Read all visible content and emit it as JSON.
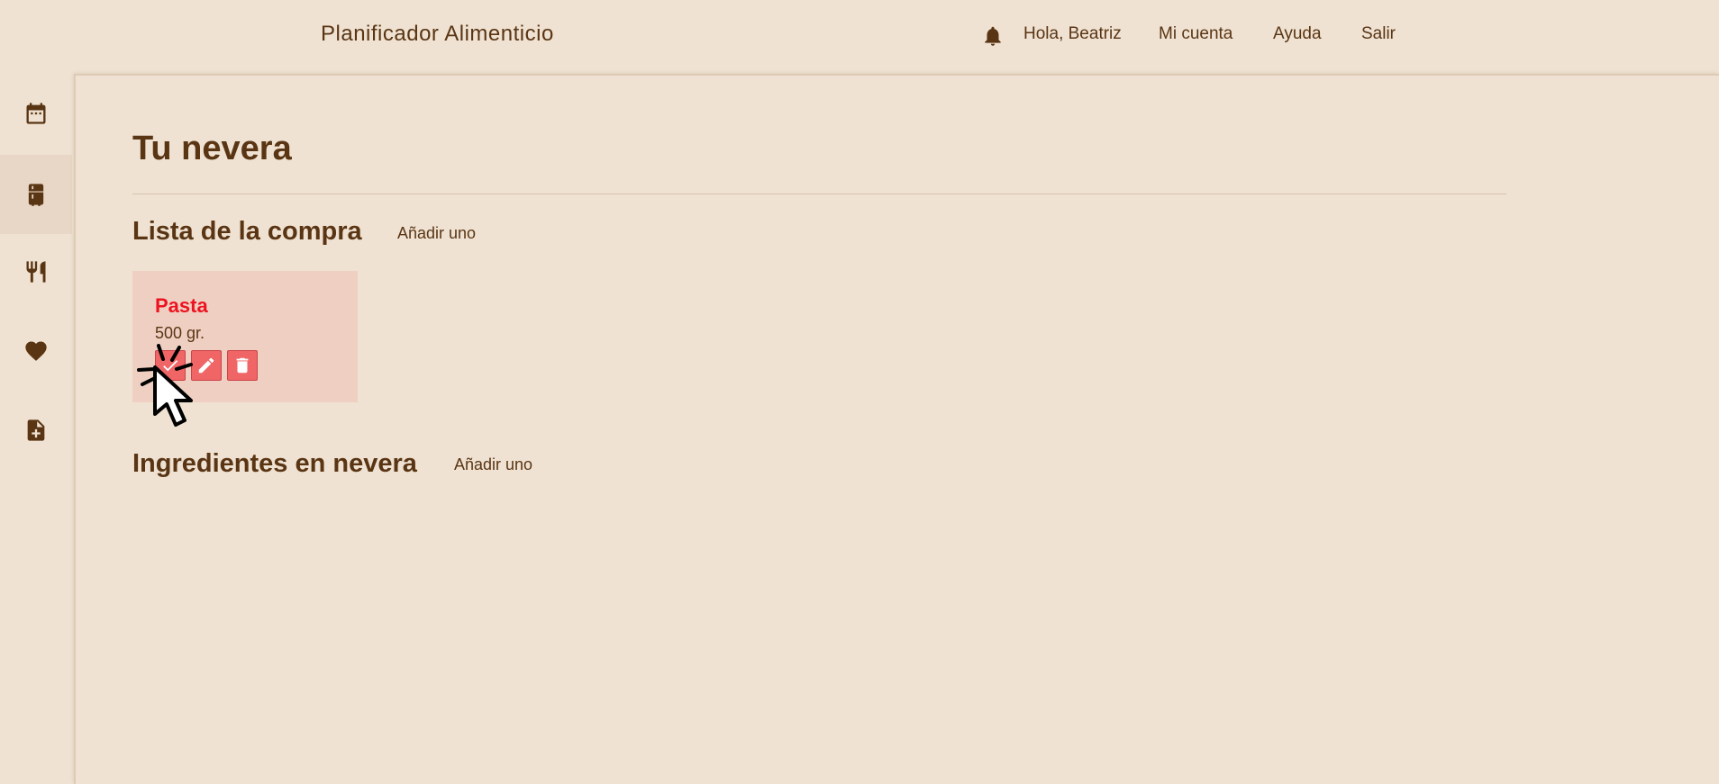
{
  "header": {
    "app_title": "Planificador Alimenticio",
    "greeting": "Hola, Beatriz",
    "account": "Mi cuenta",
    "help": "Ayuda",
    "logout": "Salir"
  },
  "sidebar": {
    "items": [
      {
        "icon": "calendar-icon"
      },
      {
        "icon": "fridge-icon",
        "active": true
      },
      {
        "icon": "cutlery-icon"
      },
      {
        "icon": "heart-icon"
      },
      {
        "icon": "add-document-icon"
      }
    ]
  },
  "main": {
    "page_title": "Tu nevera",
    "shopping_list": {
      "title": "Lista de la compra",
      "add_label": "Añadir uno",
      "items": [
        {
          "name": "Pasta",
          "quantity": "500 gr."
        }
      ]
    },
    "fridge_ingredients": {
      "title": "Ingredientes en nevera",
      "add_label": "Añadir uno"
    }
  },
  "colors": {
    "background": "#efe2d2",
    "text_brown": "#5a3514",
    "card": "#efcfc2",
    "item_name": "#ec1420",
    "action_button": "#f06566"
  }
}
